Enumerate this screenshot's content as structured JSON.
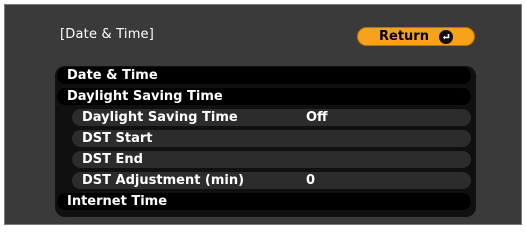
{
  "header": {
    "title": "[Date & Time]",
    "return_label": "Return",
    "return_icon": "enter-icon"
  },
  "menu": {
    "items": [
      {
        "label": "Date & Time",
        "value": ""
      },
      {
        "label": "Daylight Saving Time",
        "value": ""
      },
      {
        "label": "Daylight Saving Time",
        "value": "Off"
      },
      {
        "label": "DST Start",
        "value": ""
      },
      {
        "label": "DST End",
        "value": ""
      },
      {
        "label": "DST Adjustment (min)",
        "value": "0"
      },
      {
        "label": "Internet Time",
        "value": ""
      }
    ]
  },
  "colors": {
    "background": "#3a3a3a",
    "return_button": "#f6a21b",
    "text": "#ffffff"
  }
}
